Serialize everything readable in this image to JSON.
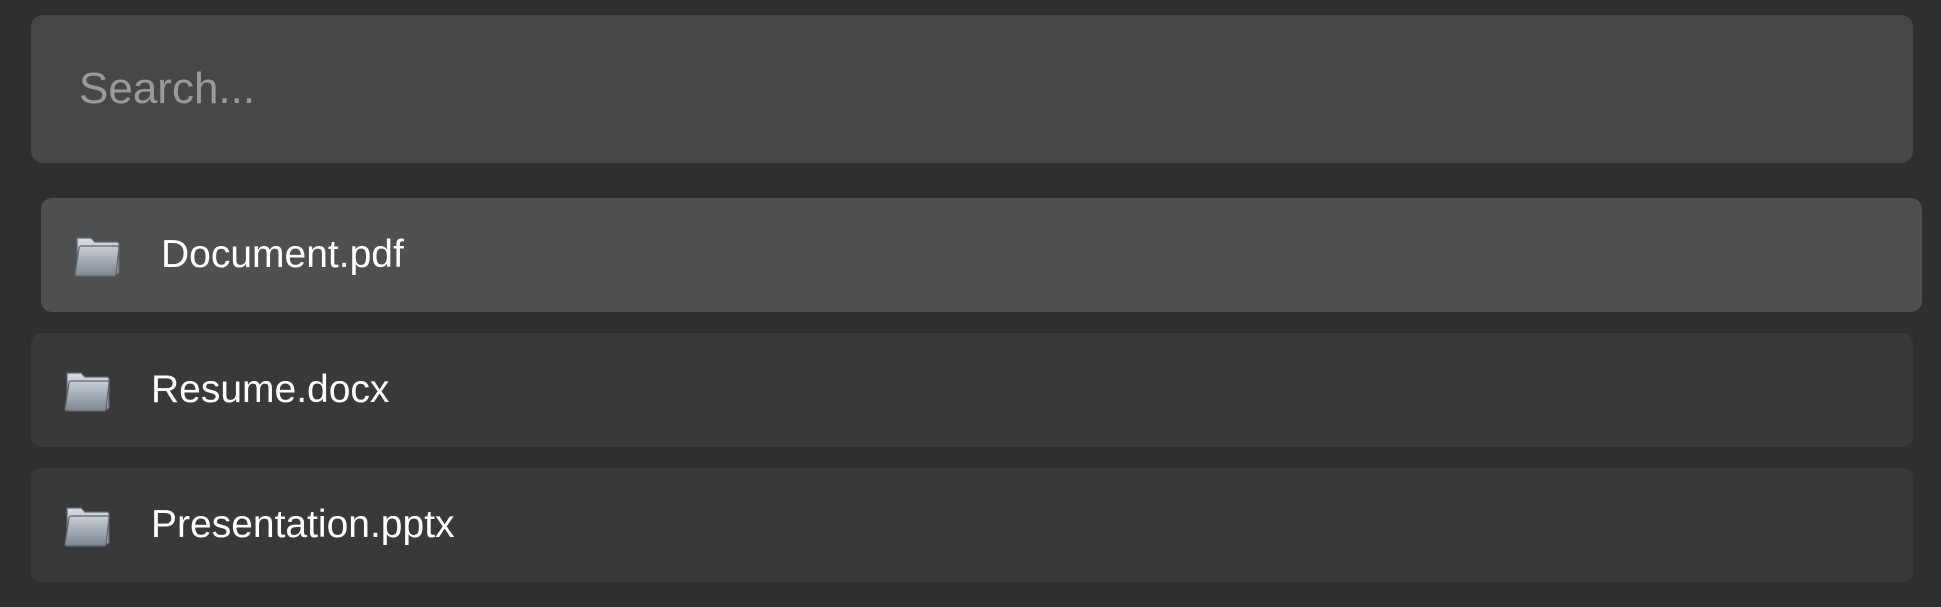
{
  "search": {
    "placeholder": "Search...",
    "value": ""
  },
  "files": [
    {
      "name": "Document.pdf",
      "icon": "folder-icon",
      "selected": true
    },
    {
      "name": "Resume.docx",
      "icon": "folder-icon",
      "selected": false
    },
    {
      "name": "Presentation.pptx",
      "icon": "folder-icon",
      "selected": false
    }
  ],
  "colors": {
    "background": "#2f2f2f",
    "search_bg": "#474747",
    "row_bg": "#393939",
    "row_selected_bg": "#4f4f4f",
    "text": "#ffffff",
    "placeholder": "#9a9a9a"
  }
}
